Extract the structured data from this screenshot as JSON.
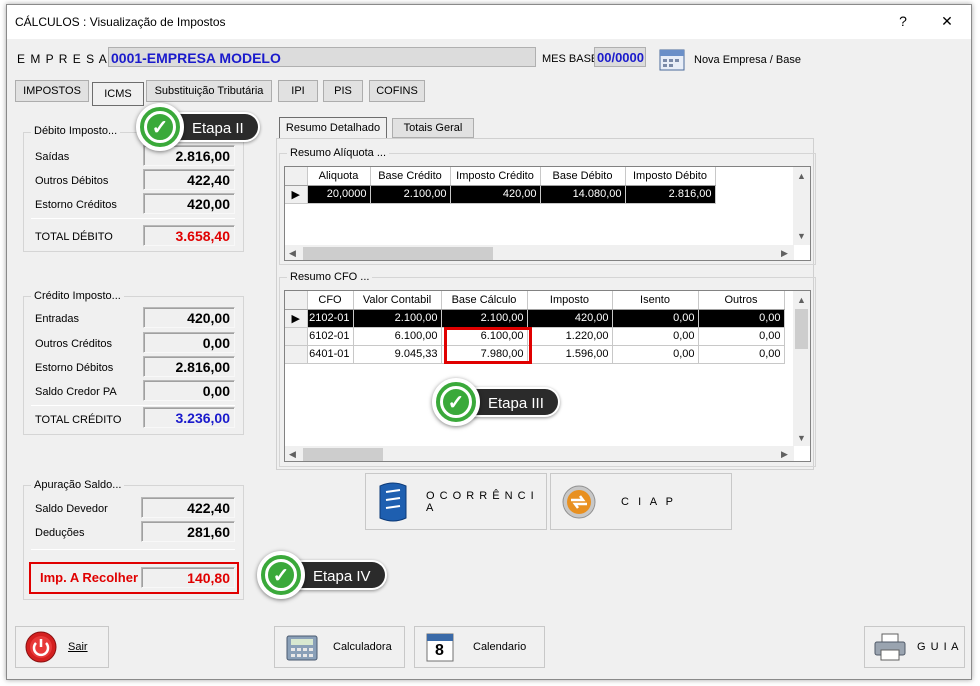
{
  "window": {
    "title": "CÁLCULOS : Visualização de Impostos",
    "help": "?",
    "close": "✕"
  },
  "header": {
    "empresa_label": "E M P R E S A",
    "empresa_value": "0001-EMPRESA MODELO",
    "mes_base_label": "MES BASE",
    "mes_base_value": "00/0000",
    "nova_empresa": "Nova Empresa / Base"
  },
  "tabs": [
    "IMPOSTOS",
    "ICMS",
    "Substituição Tributária",
    "IPI",
    "PIS",
    "COFINS"
  ],
  "subtabs": [
    "Resumo Detalhado",
    "Totais Geral"
  ],
  "debito": {
    "title": "Débito Imposto...",
    "rows": [
      {
        "label": "Saídas",
        "value": "2.816,00"
      },
      {
        "label": "Outros Débitos",
        "value": "422,40"
      },
      {
        "label": "Estorno Créditos",
        "value": "420,00"
      }
    ],
    "total_label": "TOTAL DÉBITO",
    "total_value": "3.658,40"
  },
  "credito": {
    "title": "Crédito Imposto...",
    "rows": [
      {
        "label": "Entradas",
        "value": "420,00"
      },
      {
        "label": "Outros Créditos",
        "value": "0,00"
      },
      {
        "label": "Estorno Débitos",
        "value": "2.816,00"
      },
      {
        "label": "Saldo Credor PA",
        "value": "0,00"
      }
    ],
    "total_label": "TOTAL CRÉDITO",
    "total_value": "3.236,00"
  },
  "apuracao": {
    "title": "Apuração Saldo...",
    "rows": [
      {
        "label": "Saldo Devedor",
        "value": "422,40"
      },
      {
        "label": "Deduções",
        "value": "281,60"
      }
    ],
    "recolher_label": "Imp. A Recolher",
    "recolher_value": "140,80"
  },
  "aliquota": {
    "title": "Resumo Alíquota ...",
    "headers": [
      "Aliquota",
      "Base Crédito",
      "Imposto Crédito",
      "Base Débito",
      "Imposto Débito"
    ],
    "rows": [
      [
        "20,0000",
        "2.100,00",
        "420,00",
        "14.080,00",
        "2.816,00"
      ]
    ]
  },
  "cfo": {
    "title": "Resumo CFO ...",
    "headers": [
      "CFO",
      "Valor Contabil",
      "Base Cálculo",
      "Imposto",
      "Isento",
      "Outros"
    ],
    "rows": [
      [
        "2102-01",
        "2.100,00",
        "2.100,00",
        "420,00",
        "0,00",
        "0,00"
      ],
      [
        "6102-01",
        "6.100,00",
        "6.100,00",
        "1.220,00",
        "0,00",
        "0,00"
      ],
      [
        "6401-01",
        "9.045,33",
        "7.980,00",
        "1.596,00",
        "0,00",
        "0,00"
      ]
    ]
  },
  "buttons": {
    "ocorrencia": "O C O R R Ê N C I A",
    "ciap": "C   I   A   P",
    "sair": "Sair",
    "calculadora": "Calculadora",
    "calendario": "Calendario",
    "calendario_day": "8",
    "guia": "G U I A"
  },
  "callouts": {
    "etapa2": "Etapa II",
    "etapa3": "Etapa III",
    "etapa4": "Etapa IV",
    "check": "✓"
  },
  "colors": {
    "red": "#e00000",
    "blue": "#1a1acc",
    "green": "#3aa93a",
    "highlight": "#e00000"
  }
}
